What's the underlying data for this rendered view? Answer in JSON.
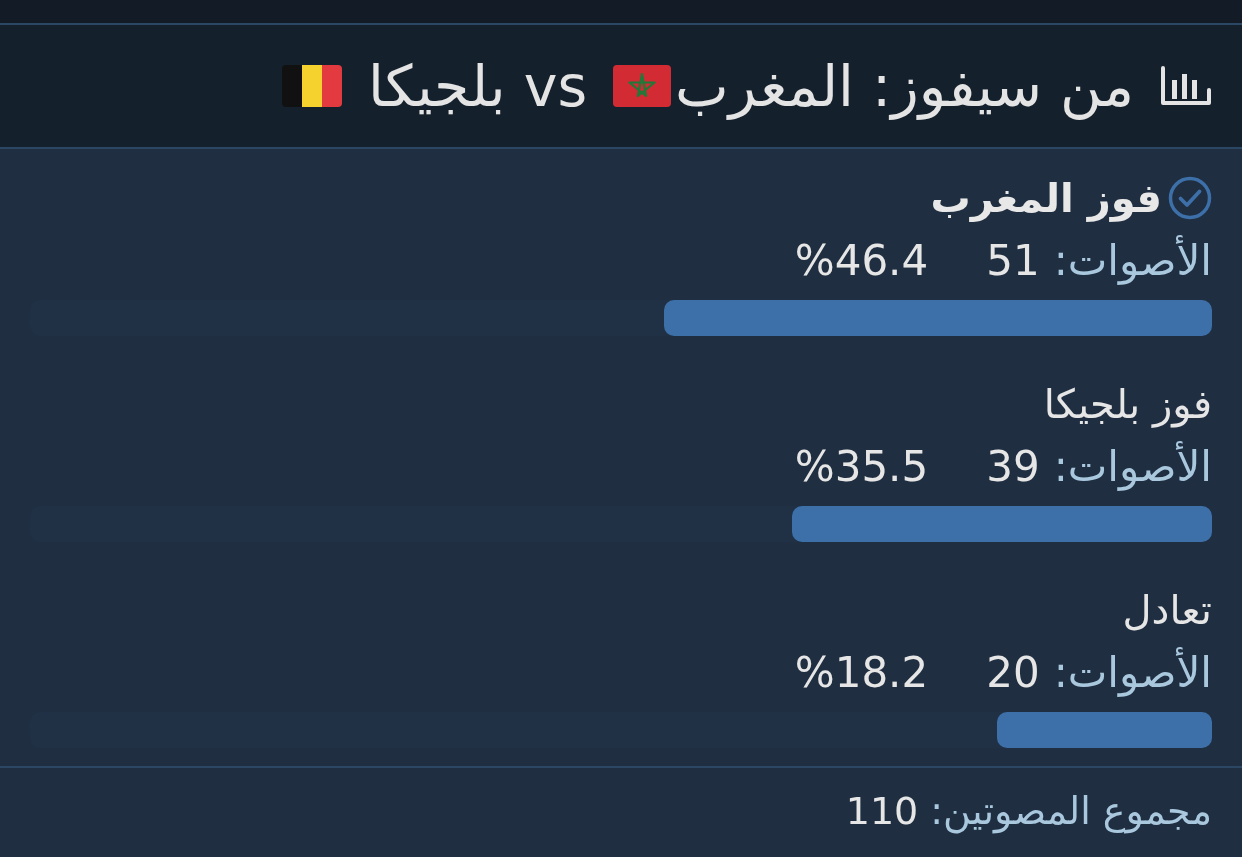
{
  "title": {
    "question": "من سيفوز: المغرب",
    "versus": "vs بلجيكا"
  },
  "options": [
    {
      "label": "فوز المغرب",
      "selected": true,
      "votes_label": "الأصوات:",
      "votes": "51",
      "percent": "%46.4",
      "level": 0.464
    },
    {
      "label": "فوز بلجيكا",
      "selected": false,
      "votes_label": "الأصوات:",
      "votes": "39",
      "percent": "%35.5",
      "level": 0.355
    },
    {
      "label": "تعادل",
      "selected": false,
      "votes_label": "الأصوات:",
      "votes": "20",
      "percent": "%18.2",
      "level": 0.182
    }
  ],
  "footer": {
    "label": "مجموع المصوتين:",
    "total": "110"
  }
}
